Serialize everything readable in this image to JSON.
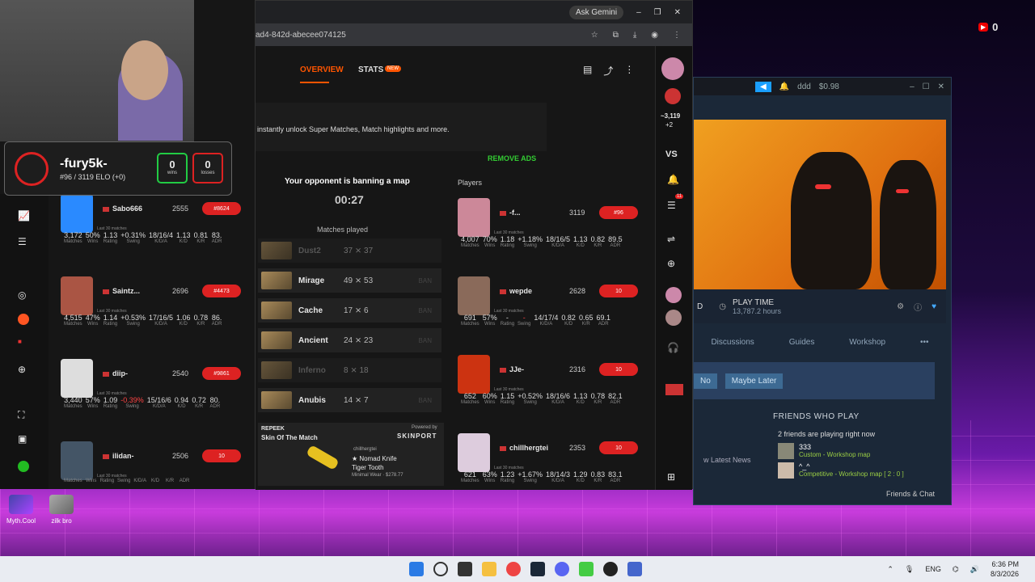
{
  "chrome": {
    "ask": "Ask Gemini",
    "url": "ad4-842d-abecee074125"
  },
  "faceit": {
    "tabs": {
      "overview": "OVERVIEW",
      "stats": "STATS",
      "new": "NEW"
    },
    "ad_text": "instantly unlock Super Matches, Match highlights and more.",
    "remove_ads": "REMOVE ADS",
    "banning": "Your opponent is banning a map",
    "timer": "00:27",
    "matches_played": "Matches played",
    "players": "Players",
    "vs": "VS",
    "maps": [
      {
        "name": "Dust2",
        "score": "37 ⨯ 37",
        "dim": true
      },
      {
        "name": "Mirage",
        "score": "49 ⨯ 53",
        "ban": "BAN"
      },
      {
        "name": "Cache",
        "score": "17 ⨯ 6",
        "ban": "BAN"
      },
      {
        "name": "Ancient",
        "score": "24 ⨯ 23",
        "ban": "BAN"
      },
      {
        "name": "Inferno",
        "score": "8 ⨯ 18",
        "dim": true
      },
      {
        "name": "Anubis",
        "score": "14 ⨯ 7",
        "ban": "BAN"
      }
    ],
    "promo": {
      "brand": "REPEEK",
      "title": "Skin Of The Match",
      "powered": "Powered by",
      "skinport": "SKINPORT",
      "user": "chillhergtei",
      "knife": "★ Nomad Knife",
      "skin": "Tiger Tooth",
      "wear": "Minimal Wear · $278.77"
    },
    "rail": {
      "elo": "~3,119",
      "plus": "+2",
      "bell_count": "11",
      "badge2": "2"
    }
  },
  "overlay": {
    "name": "-fury5k-",
    "rank": "#96 / 3119 ELO (+0)",
    "wins": "0",
    "wins_l": "wins",
    "losses": "0",
    "losses_l": "losses"
  },
  "stat_labels": [
    "Matches",
    "Wins",
    "Rating",
    "Swing",
    "K/D/A",
    "K/D",
    "K/R",
    "ADR"
  ],
  "last30": "Last 30 matches",
  "left_team": [
    {
      "name": "Sabo666",
      "elo": "2555",
      "tag": "#8624",
      "s": [
        "3,172",
        "50%",
        "1.13",
        "+0.31%",
        "18/16/4",
        "1.13",
        "0.81",
        "83."
      ],
      "c": "#2a8aff"
    },
    {
      "name": "Saintz...",
      "elo": "2696",
      "tag": "#4473",
      "s": [
        "4,515",
        "47%",
        "1.14",
        "+0.53%",
        "17/16/5",
        "1.06",
        "0.78",
        "86."
      ],
      "c": "#aa5544"
    },
    {
      "name": "diip-",
      "elo": "2540",
      "tag": "#9861",
      "s": [
        "3,440",
        "57%",
        "1.09",
        "-0.39%",
        "15/16/6",
        "0.94",
        "0.72",
        "80."
      ],
      "c": "#dddddd"
    },
    {
      "name": "ilidan-",
      "elo": "2506",
      "tag": "10",
      "s": [
        "",
        "",
        "",
        "",
        "",
        "",
        "",
        ""
      ],
      "c": "#445566"
    }
  ],
  "right_team": [
    {
      "name": "-f...",
      "elo": "3119",
      "tag": "#96",
      "s": [
        "4,007",
        "70%",
        "1.18",
        "+1.18%",
        "18/16/5",
        "1.13",
        "0.82",
        "89.5"
      ],
      "c": "#cc8899"
    },
    {
      "name": "wepde",
      "elo": "2628",
      "tag": "10",
      "s": [
        "691",
        "57%",
        "-",
        "-",
        "14/17/4",
        "0.82",
        "0.65",
        "69.1"
      ],
      "c": "#8a6a5a"
    },
    {
      "name": "JJe-",
      "elo": "2316",
      "tag": "10",
      "s": [
        "652",
        "60%",
        "1.15",
        "+0.52%",
        "18/16/6",
        "1.13",
        "0.78",
        "82.1"
      ],
      "c": "#cc3311"
    },
    {
      "name": "chillhergtei",
      "elo": "2353",
      "tag": "10",
      "s": [
        "621",
        "63%",
        "1.23",
        "+1.67%",
        "18/14/3",
        "1.29",
        "0.83",
        "83.1"
      ],
      "c": "#ddccdd"
    }
  ],
  "steam": {
    "user": "ddd",
    "balance": "$0.98",
    "playtime_l": "PLAY TIME",
    "playtime": "13,787.2 hours",
    "tabs": [
      "Discussions",
      "Guides",
      "Workshop"
    ],
    "no": "No",
    "maybe": "Maybe Later",
    "fwp": "FRIENDS WHO PLAY",
    "playing": "2 friends are playing right now",
    "f1": "333",
    "f1s": "Custom - Workshop map",
    "f2": "^_^",
    "f2s": "Competitive - Workshop map [ 2 : 0 ]",
    "news": "w Latest News",
    "fc": "Friends & Chat"
  },
  "desktop": {
    "icons": [
      "Myth.Cool",
      "zilk bro"
    ],
    "yt": "0"
  },
  "taskbar": {
    "lang": "ENG",
    "time": "6:36 PM",
    "date": "8/3/2026"
  }
}
